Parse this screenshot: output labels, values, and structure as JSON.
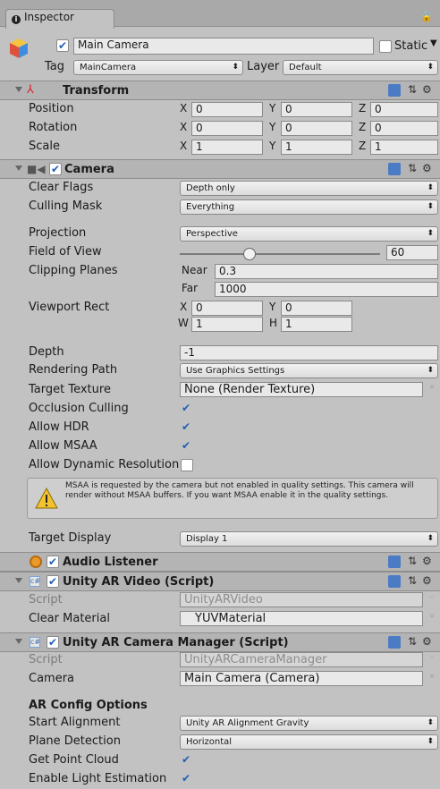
{
  "window": {
    "tab_title": "Inspector",
    "lock_glyph": "🔒"
  },
  "gameobject": {
    "name": "Main Camera",
    "static_label": "Static",
    "tag_label": "Tag",
    "tag_value": "MainCamera",
    "layer_label": "Layer",
    "layer_value": "Default",
    "active": true
  },
  "transform": {
    "title": "Transform",
    "position": {
      "label": "Position",
      "x": "0",
      "y": "0",
      "z": "0"
    },
    "rotation": {
      "label": "Rotation",
      "x": "0",
      "y": "0",
      "z": "0"
    },
    "scale": {
      "label": "Scale",
      "x": "1",
      "y": "1",
      "z": "1"
    }
  },
  "axes": {
    "x": "X",
    "y": "Y",
    "z": "Z",
    "w": "W",
    "h": "H"
  },
  "camera": {
    "title": "Camera",
    "clear_flags": {
      "label": "Clear Flags",
      "value": "Depth only"
    },
    "culling_mask": {
      "label": "Culling Mask",
      "value": "Everything"
    },
    "projection": {
      "label": "Projection",
      "value": "Perspective"
    },
    "fov": {
      "label": "Field of View",
      "value": "60"
    },
    "clipping": {
      "label": "Clipping Planes",
      "near_label": "Near",
      "near": "0.3",
      "far_label": "Far",
      "far": "1000"
    },
    "viewport": {
      "label": "Viewport Rect",
      "x": "0",
      "y": "0",
      "w": "1",
      "h": "1"
    },
    "depth": {
      "label": "Depth",
      "value": "-1"
    },
    "rendering_path": {
      "label": "Rendering Path",
      "value": "Use Graphics Settings"
    },
    "target_texture": {
      "label": "Target Texture",
      "value": "None (Render Texture)"
    },
    "occlusion": {
      "label": "Occlusion Culling",
      "checked": true
    },
    "hdr": {
      "label": "Allow HDR",
      "checked": true
    },
    "msaa": {
      "label": "Allow MSAA",
      "checked": true
    },
    "dynres": {
      "label": "Allow Dynamic Resolution",
      "checked": false
    },
    "warning": "MSAA is requested by the camera but not enabled in quality settings. This camera will render without MSAA buffers. If you want MSAA enable it in the quality settings.",
    "target_display": {
      "label": "Target Display",
      "value": "Display 1"
    }
  },
  "audio_listener": {
    "title": "Audio Listener"
  },
  "ar_video": {
    "title": "Unity AR Video (Script)",
    "script_label": "Script",
    "script_value": "UnityARVideo",
    "material_label": "Clear Material",
    "material_value": "YUVMaterial"
  },
  "ar_manager": {
    "title": "Unity AR Camera Manager (Script)",
    "script_label": "Script",
    "script_value": "UnityARCameraManager",
    "camera_label": "Camera",
    "camera_value": "Main Camera (Camera)",
    "config_title": "AR Config Options",
    "start_alignment": {
      "label": "Start Alignment",
      "value": "Unity AR Alignment Gravity"
    },
    "plane_detection": {
      "label": "Plane Detection",
      "value": "Horizontal"
    },
    "point_cloud": {
      "label": "Get Point Cloud",
      "checked": true
    },
    "light_estimation": {
      "label": "Enable Light Estimation",
      "checked": true
    }
  },
  "check_glyph": "✔",
  "object_picker_glyph": "◦"
}
